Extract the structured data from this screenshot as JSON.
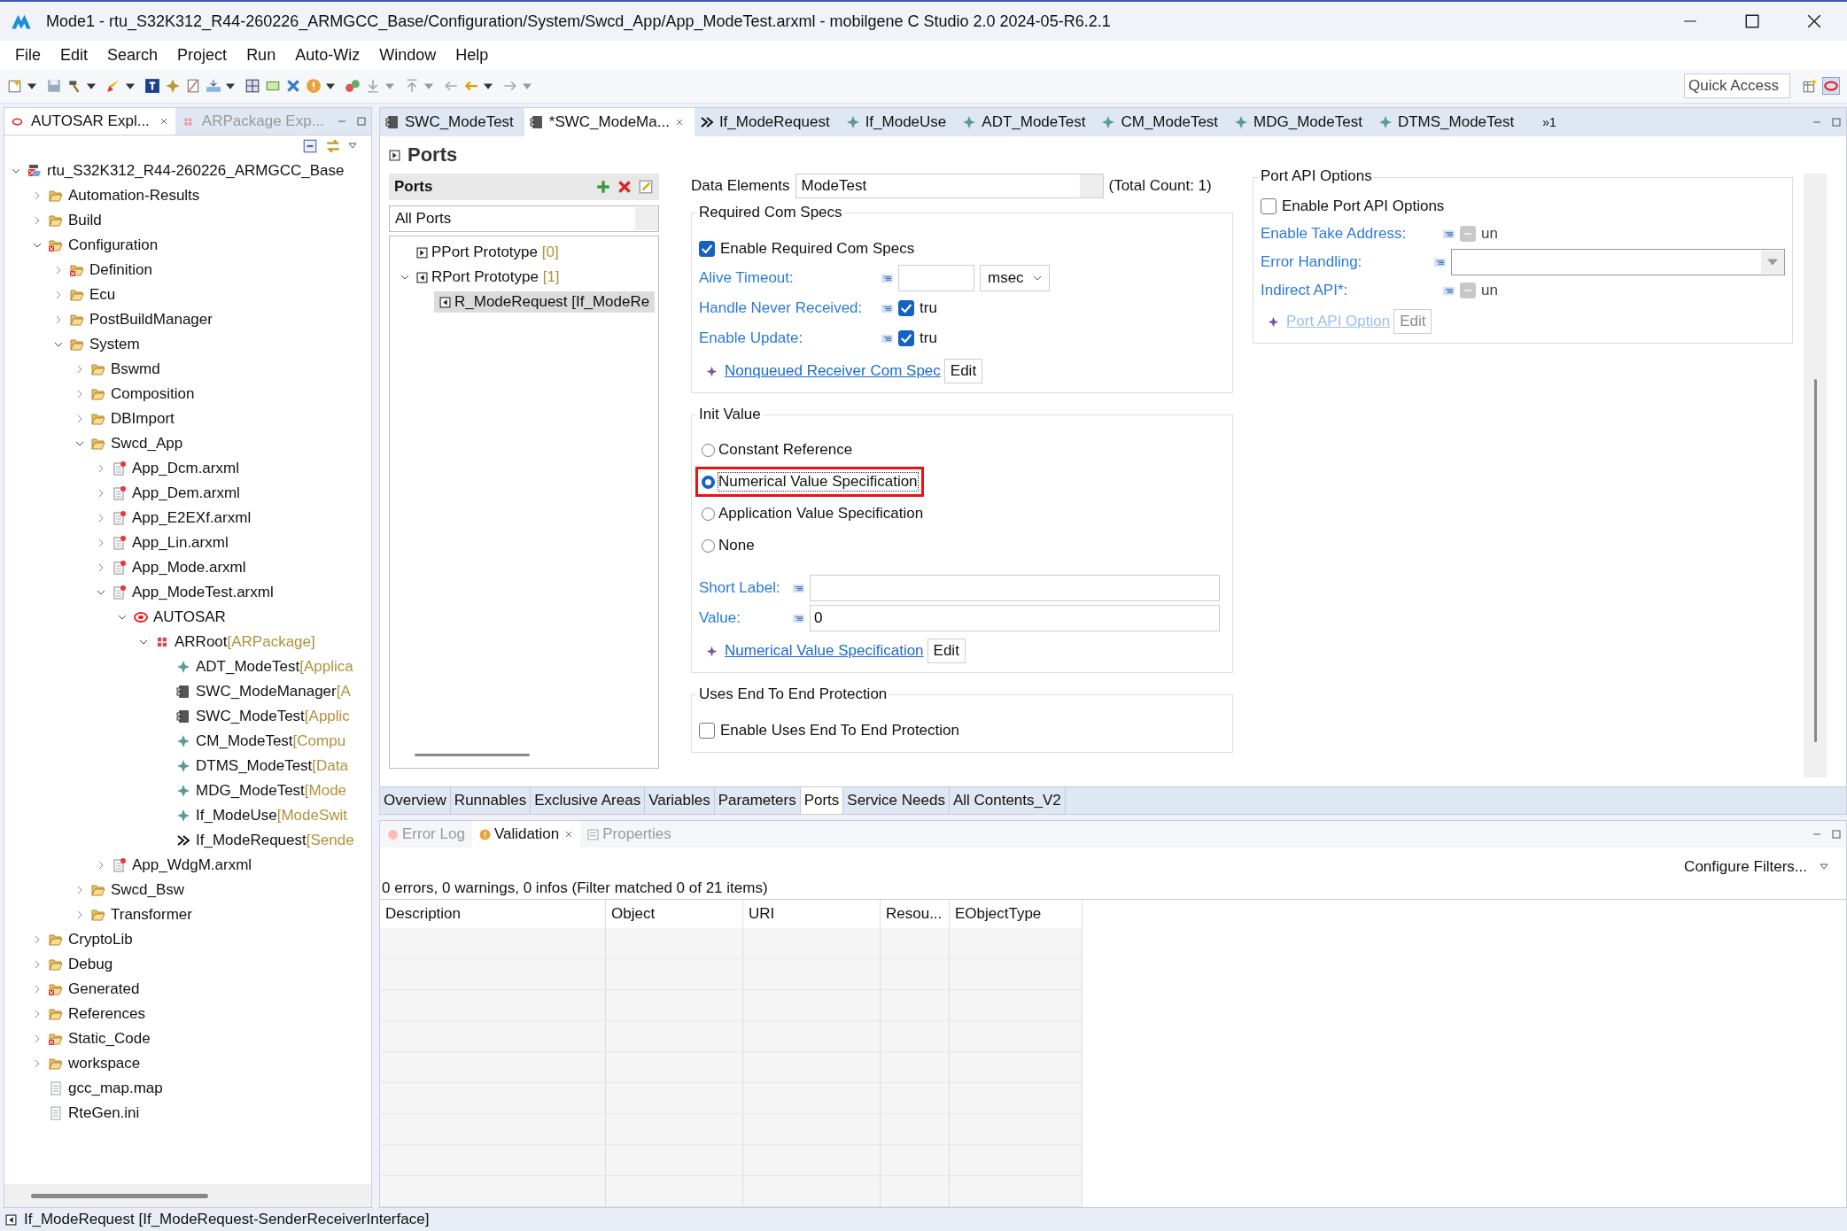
{
  "window": {
    "title": "Mode1 - rtu_S32K312_R44-260226_ARMGCC_Base/Configuration/System/Swcd_App/App_ModeTest.arxml - mobilgene C Studio 2.0 2024-05-R6.2.1"
  },
  "menu": [
    "File",
    "Edit",
    "Search",
    "Project",
    "Run",
    "Auto-Wiz",
    "Window",
    "Help"
  ],
  "quick_access": {
    "placeholder": "Quick Access"
  },
  "explorer": {
    "tabs": [
      {
        "label": "AUTOSAR Expl...",
        "selected": true
      },
      {
        "label": "ARPackage Exp...",
        "selected": false
      }
    ],
    "tree": [
      {
        "label": "rtu_S32K312_R44-260226_ARMGCC_Base",
        "kind": "project",
        "expanded": true,
        "children": [
          {
            "label": "Automation-Results",
            "kind": "folder",
            "expanded": false
          },
          {
            "label": "Build",
            "kind": "folder",
            "expanded": false
          },
          {
            "label": "Configuration",
            "kind": "folder-error",
            "expanded": true,
            "children": [
              {
                "label": "Definition",
                "kind": "folder-error",
                "expanded": false
              },
              {
                "label": "Ecu",
                "kind": "folder",
                "expanded": false
              },
              {
                "label": "PostBuildManager",
                "kind": "folder",
                "expanded": false
              },
              {
                "label": "System",
                "kind": "folder",
                "expanded": true,
                "children": [
                  {
                    "label": "Bswmd",
                    "kind": "folder",
                    "expanded": false
                  },
                  {
                    "label": "Composition",
                    "kind": "folder",
                    "expanded": false
                  },
                  {
                    "label": "DBImport",
                    "kind": "folder",
                    "expanded": false
                  },
                  {
                    "label": "Swcd_App",
                    "kind": "folder",
                    "expanded": true,
                    "children": [
                      {
                        "label": "App_Dcm.arxml",
                        "kind": "file",
                        "expanded": false
                      },
                      {
                        "label": "App_Dem.arxml",
                        "kind": "file",
                        "expanded": false
                      },
                      {
                        "label": "App_E2EXf.arxml",
                        "kind": "file",
                        "expanded": false
                      },
                      {
                        "label": "App_Lin.arxml",
                        "kind": "file",
                        "expanded": false
                      },
                      {
                        "label": "App_Mode.arxml",
                        "kind": "file",
                        "expanded": false
                      },
                      {
                        "label": "App_ModeTest.arxml",
                        "kind": "file",
                        "expanded": true,
                        "children": [
                          {
                            "label": "AUTOSAR",
                            "kind": "autosar",
                            "expanded": true,
                            "children": [
                              {
                                "label": "ARRoot",
                                "type": "[ARPackage]",
                                "kind": "package",
                                "expanded": true,
                                "children": [
                                  {
                                    "label": "ADT_ModeTest",
                                    "type": "[Applica",
                                    "kind": "element"
                                  },
                                  {
                                    "label": "SWC_ModeManager",
                                    "type": "[A",
                                    "kind": "component"
                                  },
                                  {
                                    "label": "SWC_ModeTest",
                                    "type": "[Applic",
                                    "kind": "component"
                                  },
                                  {
                                    "label": "CM_ModeTest",
                                    "type": "[Compu",
                                    "kind": "element"
                                  },
                                  {
                                    "label": "DTMS_ModeTest",
                                    "type": "[Data",
                                    "kind": "element"
                                  },
                                  {
                                    "label": "MDG_ModeTest",
                                    "type": "[Mode",
                                    "kind": "element"
                                  },
                                  {
                                    "label": "If_ModeUse",
                                    "type": "[ModeSwit",
                                    "kind": "element"
                                  },
                                  {
                                    "label": "If_ModeRequest",
                                    "type": "[Sende",
                                    "kind": "interface"
                                  }
                                ]
                              }
                            ]
                          }
                        ]
                      },
                      {
                        "label": "App_WdgM.arxml",
                        "kind": "file",
                        "expanded": false
                      }
                    ]
                  },
                  {
                    "label": "Swcd_Bsw",
                    "kind": "folder",
                    "expanded": false
                  },
                  {
                    "label": "Transformer",
                    "kind": "folder",
                    "expanded": false
                  }
                ]
              }
            ]
          },
          {
            "label": "CryptoLib",
            "kind": "folder",
            "expanded": false
          },
          {
            "label": "Debug",
            "kind": "folder",
            "expanded": false
          },
          {
            "label": "Generated",
            "kind": "folder-error",
            "expanded": false
          },
          {
            "label": "References",
            "kind": "folder",
            "expanded": false
          },
          {
            "label": "Static_Code",
            "kind": "folder-error",
            "expanded": false
          },
          {
            "label": "workspace",
            "kind": "folder",
            "expanded": false
          },
          {
            "label": "gcc_map.map",
            "kind": "textfile"
          },
          {
            "label": "RteGen.ini",
            "kind": "textfile"
          }
        ]
      }
    ]
  },
  "editor_tabs": [
    {
      "label": "SWC_ModeTest",
      "kind": "component",
      "selected": false
    },
    {
      "label": "*SWC_ModeMa...",
      "kind": "component",
      "selected": true
    },
    {
      "label": "If_ModeRequest",
      "kind": "interface",
      "selected": false
    },
    {
      "label": "If_ModeUse",
      "kind": "element",
      "selected": false
    },
    {
      "label": "ADT_ModeTest",
      "kind": "element",
      "selected": false
    },
    {
      "label": "CM_ModeTest",
      "kind": "element",
      "selected": false
    },
    {
      "label": "MDG_ModeTest",
      "kind": "element",
      "selected": false
    },
    {
      "label": "DTMS_ModeTest",
      "kind": "element",
      "selected": false
    }
  ],
  "editor_tabs_overflow": "»1",
  "page_title": "Ports",
  "ports": {
    "title": "Ports",
    "filter": "All Ports",
    "tree": [
      {
        "label": "PPort Prototype",
        "count": "[0]"
      },
      {
        "label": "RPort Prototype",
        "count": "[1]",
        "expanded": true,
        "children": [
          {
            "label": "R_ModeRequest [If_ModeRe",
            "selected": true
          }
        ]
      }
    ]
  },
  "data_elements": {
    "label": "Data Elements",
    "value": "ModeTest",
    "total": "(Total Count: 1)"
  },
  "required_com_specs": {
    "title": "Required Com Specs",
    "enable": {
      "label": "Enable Required Com Specs",
      "checked": true
    },
    "fields": [
      {
        "kind": "number",
        "label": "Alive Timeout:",
        "unit": "msec"
      },
      {
        "kind": "check",
        "label": "Handle Never Received:",
        "checked": true,
        "value": "tru"
      },
      {
        "kind": "check",
        "label": "Enable Update:",
        "checked": true,
        "value": "tru"
      }
    ],
    "link": {
      "label": "Nonqueued Receiver Com Spec",
      "button": "Edit",
      "disabled": false
    }
  },
  "init_value": {
    "title": "Init Value",
    "options": [
      {
        "label": "Constant Reference",
        "selected": false,
        "highlighted": false
      },
      {
        "label": "Numerical Value Specification",
        "selected": true,
        "highlighted": true
      },
      {
        "label": "Application Value Specification",
        "selected": false,
        "highlighted": false
      },
      {
        "label": "None",
        "selected": false,
        "highlighted": false
      }
    ],
    "fields": [
      {
        "label": "Short Label:"
      },
      {
        "label": "Value:",
        "value": "0"
      }
    ],
    "link": {
      "label": "Numerical Value Specification",
      "button": "Edit",
      "disabled": false
    }
  },
  "e2e": {
    "title": "Uses End To End Protection",
    "enable": {
      "label": "Enable Uses End To End Protection",
      "checked": false
    }
  },
  "port_api": {
    "title": "Port API Options",
    "enable": {
      "label": "Enable Port API Options",
      "checked": false
    },
    "fields": [
      {
        "kind": "tristate",
        "label": "Enable Take Address:",
        "indeterminate": true,
        "value": "un"
      },
      {
        "kind": "combo",
        "label": "Error Handling:"
      },
      {
        "kind": "tristate",
        "label": "Indirect API*:",
        "indeterminate": true,
        "value": "un"
      }
    ],
    "link": {
      "label": "Port API Option",
      "button": "Edit",
      "disabled": true
    }
  },
  "page_tabs": [
    {
      "label": "Overview",
      "selected": false
    },
    {
      "label": "Runnables",
      "selected": false
    },
    {
      "label": "Exclusive Areas",
      "selected": false
    },
    {
      "label": "Variables",
      "selected": false
    },
    {
      "label": "Parameters",
      "selected": false
    },
    {
      "label": "Ports",
      "selected": true
    },
    {
      "label": "Service Needs",
      "selected": false
    },
    {
      "label": "All Contents_V2",
      "selected": false
    }
  ],
  "view_tabs": [
    {
      "label": "Error Log",
      "kind": "log",
      "selected": false
    },
    {
      "label": "Validation",
      "kind": "warning",
      "selected": true
    },
    {
      "label": "Properties",
      "kind": "properties",
      "selected": false
    }
  ],
  "configure_filters": "Configure Filters...",
  "summary": "0 errors, 0 warnings, 0 infos (Filter matched 0 of 21 items)",
  "table": {
    "columns": [
      "Description",
      "Object",
      "URI",
      "Resou...",
      "EObjectType"
    ]
  },
  "status_bar": "If_ModeRequest [If_ModeRequest-SenderReceiverInterface]"
}
